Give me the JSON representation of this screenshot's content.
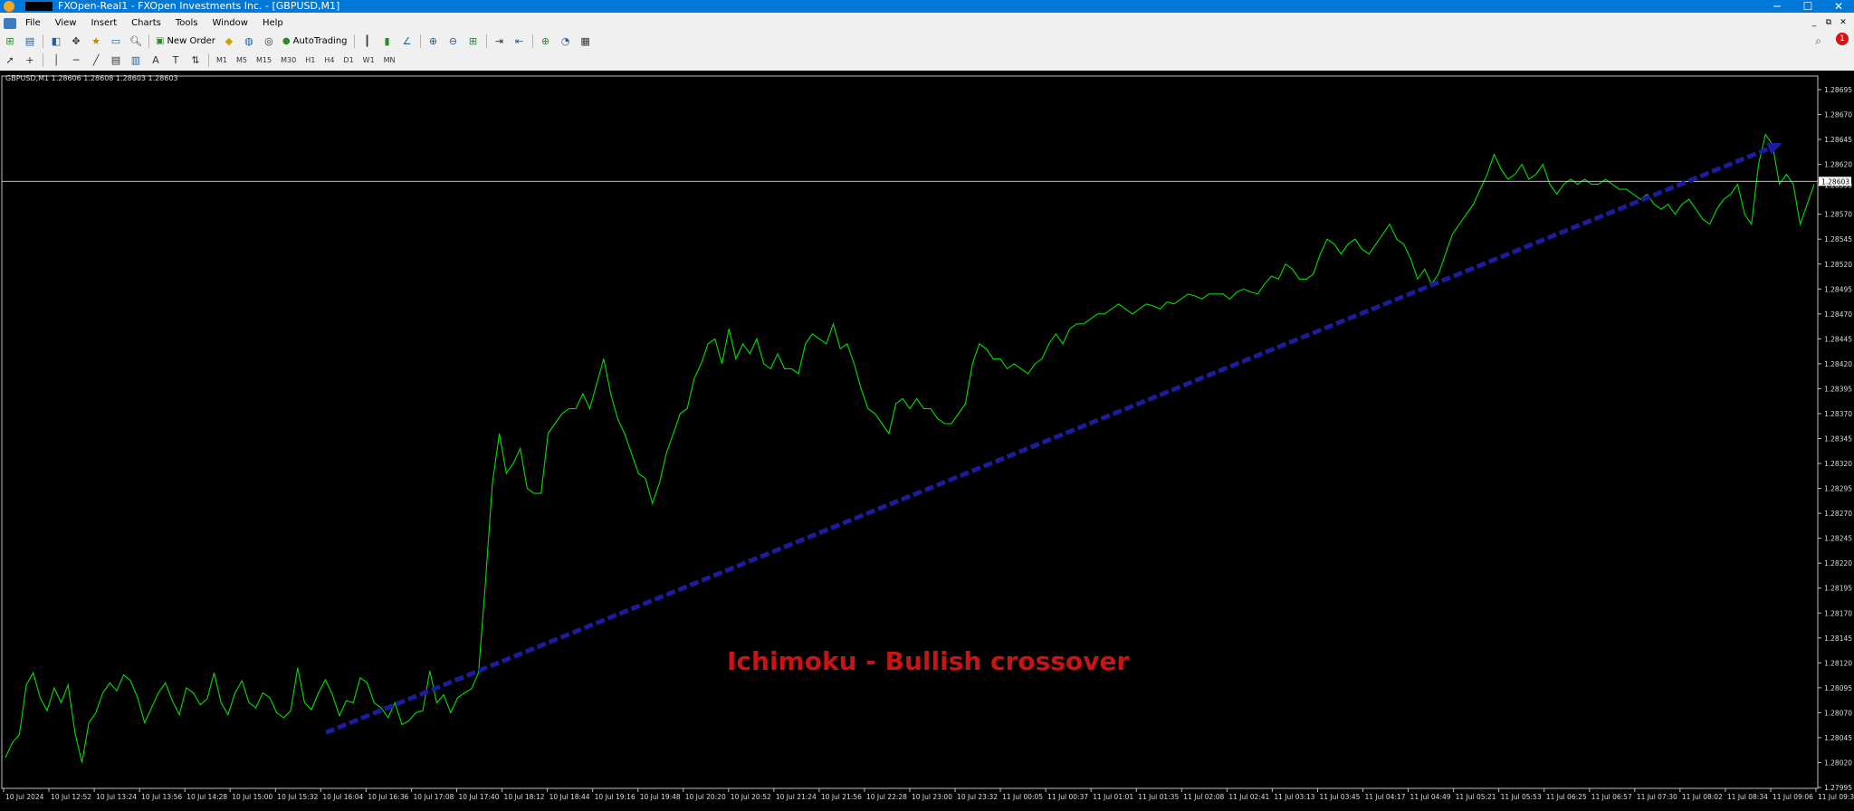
{
  "window": {
    "title": "FXOpen-Real1 - FXOpen Investments Inc. - [GBPUSD,M1]",
    "controls": [
      "─",
      "☐",
      "✕"
    ]
  },
  "menu": {
    "items": [
      "File",
      "View",
      "Insert",
      "Charts",
      "Tools",
      "Window",
      "Help"
    ],
    "mdi_controls": [
      "_",
      "⧉",
      "✕"
    ]
  },
  "toolbar": {
    "new_order_label": "New Order",
    "autotrading_label": "AutoTrading",
    "timeframes": [
      "M1",
      "M5",
      "M15",
      "M30",
      "H1",
      "H4",
      "D1",
      "W1",
      "MN"
    ],
    "notification_count": "1"
  },
  "chart": {
    "header": "GBPUSD,M1  1.28606 1.28608 1.28603 1.28603",
    "current_price": "1.28603",
    "annotation": "Ichimoku - Bullish crossover",
    "colors": {
      "background": "#000000",
      "line": "#00e000",
      "trendline": "#1c1c9c",
      "annotation": "#c81414",
      "grid_text": "#dddddd"
    }
  },
  "chart_data": {
    "type": "line",
    "symbol": "GBPUSD",
    "timeframe": "M1",
    "y_ticks": [
      1.28695,
      1.2867,
      1.28645,
      1.2862,
      1.28599,
      1.2857,
      1.28545,
      1.2852,
      1.28495,
      1.2847,
      1.28445,
      1.2842,
      1.28395,
      1.2837,
      1.28345,
      1.2832,
      1.28295,
      1.2827,
      1.28245,
      1.2822,
      1.28195,
      1.2817,
      1.28145,
      1.2812,
      1.28095,
      1.2807,
      1.28045,
      1.2802,
      1.27995
    ],
    "y_tick_labels": [
      "1.28695",
      "1.28670",
      "1.28645",
      "1.28620",
      "1.28599",
      "1.28570",
      "1.28545",
      "1.28520",
      "1.28495",
      "1.28470",
      "1.28445",
      "1.28420",
      "1.28395",
      "1.28370",
      "1.28345",
      "1.28320",
      "1.28295",
      "1.28270",
      "1.28245",
      "1.28220",
      "1.28195",
      "1.28170",
      "1.28145",
      "1.28120",
      "1.28095",
      "1.28070",
      "1.28045",
      "1.28020",
      "1.27995"
    ],
    "ylim": [
      1.27995,
      1.28695
    ],
    "x_tick_labels": [
      "10 Jul 2024",
      "10 Jul 12:52",
      "10 Jul 13:24",
      "10 Jul 13:56",
      "10 Jul 14:28",
      "10 Jul 15:00",
      "10 Jul 15:32",
      "10 Jul 16:04",
      "10 Jul 16:36",
      "10 Jul 17:08",
      "10 Jul 17:40",
      "10 Jul 18:12",
      "10 Jul 18:44",
      "10 Jul 19:16",
      "10 Jul 19:48",
      "10 Jul 20:20",
      "10 Jul 20:52",
      "10 Jul 21:24",
      "10 Jul 21:56",
      "10 Jul 22:28",
      "10 Jul 23:00",
      "10 Jul 23:32",
      "11 Jul 00:05",
      "11 Jul 00:37",
      "11 Jul 01:01",
      "11 Jul 01:35",
      "11 Jul 02:08",
      "11 Jul 02:41",
      "11 Jul 03:13",
      "11 Jul 03:45",
      "11 Jul 04:17",
      "11 Jul 04:49",
      "11 Jul 05:21",
      "11 Jul 05:53",
      "11 Jul 06:25",
      "11 Jul 06:57",
      "11 Jul 07:30",
      "11 Jul 08:02",
      "11 Jul 08:34",
      "11 Jul 09:06",
      "11 Jul 09:38"
    ],
    "series": [
      {
        "values": [
          1.28025,
          1.2804,
          1.28048,
          1.28098,
          1.2811,
          1.28085,
          1.28072,
          1.28095,
          1.2808,
          1.28098,
          1.2805,
          1.2802,
          1.2806,
          1.2807,
          1.2809,
          1.281,
          1.28092,
          1.28108,
          1.28102,
          1.28085,
          1.2806,
          1.28075,
          1.2809,
          1.281,
          1.28082,
          1.28068,
          1.28095,
          1.2809,
          1.28078,
          1.28084,
          1.2811,
          1.2808,
          1.28068,
          1.2809,
          1.28102,
          1.2808,
          1.28075,
          1.2809,
          1.28085,
          1.2807,
          1.28065,
          1.28072,
          1.28115,
          1.2808,
          1.28073,
          1.2809,
          1.28103,
          1.28088,
          1.28067,
          1.28082,
          1.2808,
          1.28105,
          1.281,
          1.2808,
          1.28075,
          1.28065,
          1.2808,
          1.28058,
          1.28062,
          1.2807,
          1.28072,
          1.28112,
          1.2808,
          1.28088,
          1.2807,
          1.28085,
          1.2809,
          1.28094,
          1.2811,
          1.282,
          1.283,
          1.2835,
          1.2831,
          1.2832,
          1.28335,
          1.28295,
          1.2829,
          1.2829,
          1.2835,
          1.2836,
          1.2837,
          1.28375,
          1.28375,
          1.2839,
          1.28375,
          1.284,
          1.28425,
          1.2839,
          1.28365,
          1.2835,
          1.2833,
          1.2831,
          1.28305,
          1.2828,
          1.283,
          1.2833,
          1.2835,
          1.2837,
          1.28375,
          1.28405,
          1.2842,
          1.2844,
          1.28445,
          1.2842,
          1.28455,
          1.28425,
          1.2844,
          1.2843,
          1.28445,
          1.2842,
          1.28415,
          1.2843,
          1.28415,
          1.28415,
          1.2841,
          1.2844,
          1.2845,
          1.28445,
          1.2844,
          1.2846,
          1.28435,
          1.2844,
          1.2842,
          1.28395,
          1.28375,
          1.2837,
          1.2836,
          1.2835,
          1.2838,
          1.28385,
          1.28375,
          1.28385,
          1.28375,
          1.28375,
          1.28365,
          1.2836,
          1.2836,
          1.2837,
          1.2838,
          1.2842,
          1.2844,
          1.28435,
          1.28425,
          1.28425,
          1.28415,
          1.2842,
          1.28415,
          1.2841,
          1.2842,
          1.28425,
          1.2844,
          1.2845,
          1.2844,
          1.28455,
          1.2846,
          1.2846,
          1.28465,
          1.2847,
          1.2847,
          1.28475,
          1.2848,
          1.28475,
          1.2847,
          1.28475,
          1.2848,
          1.28478,
          1.28475,
          1.28482,
          1.2848,
          1.28485,
          1.2849,
          1.28488,
          1.28485,
          1.2849,
          1.2849,
          1.2849,
          1.28485,
          1.28492,
          1.28495,
          1.28492,
          1.2849,
          1.285,
          1.28508,
          1.28505,
          1.2852,
          1.28515,
          1.28505,
          1.28505,
          1.2851,
          1.2853,
          1.28545,
          1.2854,
          1.2853,
          1.2854,
          1.28545,
          1.28535,
          1.2853,
          1.2854,
          1.2855,
          1.2856,
          1.28545,
          1.2854,
          1.28525,
          1.28505,
          1.28515,
          1.285,
          1.2851,
          1.2853,
          1.2855,
          1.2856,
          1.2857,
          1.2858,
          1.28595,
          1.2861,
          1.2863,
          1.28615,
          1.28605,
          1.2861,
          1.2862,
          1.28605,
          1.2861,
          1.2862,
          1.286,
          1.2859,
          1.286,
          1.28605,
          1.286,
          1.28605,
          1.286,
          1.286,
          1.28605,
          1.286,
          1.28595,
          1.28595,
          1.2859,
          1.28585,
          1.2859,
          1.2858,
          1.28575,
          1.2858,
          1.2857,
          1.2858,
          1.28585,
          1.28575,
          1.28565,
          1.2856,
          1.28575,
          1.28585,
          1.2859,
          1.286,
          1.2857,
          1.2856,
          1.2862,
          1.2865,
          1.2864,
          1.286,
          1.2861,
          1.286,
          1.2856,
          1.2858,
          1.286
        ],
        "x_step_minutes": 3.05
      }
    ],
    "trendline": {
      "from": [
        "10 Jul 16:05",
        1.2805
      ],
      "to": [
        "11 Jul 09:10",
        1.2864
      ]
    }
  }
}
